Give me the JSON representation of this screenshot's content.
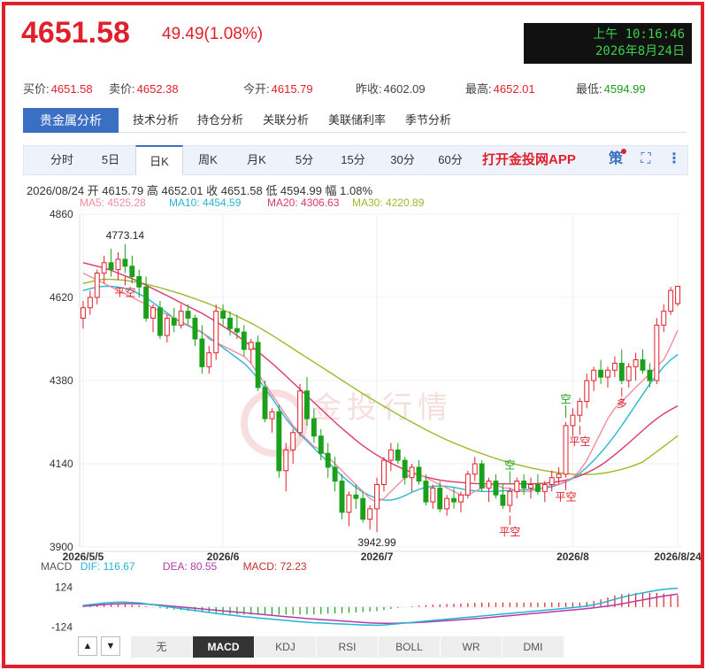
{
  "header": {
    "price": "4651.58",
    "change": "49.49(1.08%)",
    "clock_time": "上午 10:16:46",
    "clock_date": "2026年8月24日"
  },
  "quotes": [
    {
      "label": "买价:",
      "value": "4651.58",
      "tone": "red"
    },
    {
      "label": "卖价:",
      "value": "4652.38",
      "tone": "red"
    },
    {
      "label": "今开:",
      "value": "4615.79",
      "tone": "red"
    },
    {
      "label": "昨收:",
      "value": "4602.09",
      "tone": "plain"
    },
    {
      "label": "最高:",
      "value": "4652.01",
      "tone": "red"
    },
    {
      "label": "最低:",
      "value": "4594.99",
      "tone": "green"
    }
  ],
  "tabs": [
    "贵金属分析",
    "技术分析",
    "持仓分析",
    "关联分析",
    "美联储利率",
    "季节分析"
  ],
  "periods": [
    "分时",
    "5日",
    "日K",
    "周K",
    "月K",
    "5分",
    "15分",
    "30分",
    "60分"
  ],
  "active_period": "日K",
  "app_link": "打开金投网APP",
  "strategy_icon_label": "策",
  "info": {
    "line": "2026/08/24 开 4615.79 高 4652.01 收 4651.58 低 4594.99 幅 1.08%",
    "ma5": "MA5: 4525.28",
    "ma10": "MA10: 4454.59",
    "ma20": "MA20: 4306.63",
    "ma30": "MA30: 4220.89"
  },
  "macd_info": {
    "label": "MACD",
    "dif": "DIF: 116.67",
    "dea": "DEA: 80.55",
    "macd": "MACD: 72.23"
  },
  "indicator_buttons": [
    "无",
    "MACD",
    "KDJ",
    "RSI",
    "BOLL",
    "WR",
    "DMI"
  ],
  "active_indicator": "MACD",
  "watermark": "金投行情",
  "colors": {
    "up": "#e0202a",
    "down": "#1aa01a",
    "ma5": "#f08ca0",
    "ma10": "#2ab5d0",
    "ma20": "#d93a6a",
    "ma30": "#9aba2a",
    "dif": "#22b5d3",
    "dea": "#b43aa8"
  },
  "chart_data": {
    "type": "candlestick",
    "y_ticks": [
      "4860",
      "4620",
      "4380",
      "4140",
      "3900"
    ],
    "ylim": [
      3900,
      4860
    ],
    "x_ticks": [
      {
        "label": "2026/5/5",
        "index": 0
      },
      {
        "label": "2026/6",
        "index": 20
      },
      {
        "label": "2026/7",
        "index": 42
      },
      {
        "label": "2026/8",
        "index": 70
      },
      {
        "label": "2026/8/24",
        "index": 85
      }
    ],
    "annotations": [
      {
        "text": "4773.14",
        "index": 6,
        "value": 4773.14,
        "kind": "high"
      },
      {
        "text": "3942.99",
        "index": 42,
        "value": 3942.99,
        "kind": "low"
      }
    ],
    "signals": [
      {
        "text": "平空",
        "index": 6,
        "pos": "below"
      },
      {
        "text": "空",
        "index": 61,
        "pos": "above"
      },
      {
        "text": "平空",
        "index": 61,
        "pos": "below"
      },
      {
        "text": "空",
        "index": 69,
        "pos": "above"
      },
      {
        "text": "平空",
        "index": 69,
        "pos": "below"
      },
      {
        "text": "平空",
        "index": 71,
        "pos": "below"
      },
      {
        "text": "多",
        "index": 77,
        "pos": "below"
      }
    ],
    "ohlc": [
      [
        4560,
        4610,
        4530,
        4590
      ],
      [
        4590,
        4640,
        4570,
        4620
      ],
      [
        4620,
        4700,
        4600,
        4690
      ],
      [
        4690,
        4740,
        4660,
        4720
      ],
      [
        4720,
        4760,
        4680,
        4700
      ],
      [
        4700,
        4750,
        4670,
        4730
      ],
      [
        4730,
        4773,
        4690,
        4710
      ],
      [
        4710,
        4740,
        4660,
        4680
      ],
      [
        4680,
        4700,
        4620,
        4650
      ],
      [
        4650,
        4680,
        4550,
        4560
      ],
      [
        4560,
        4600,
        4520,
        4590
      ],
      [
        4590,
        4610,
        4500,
        4510
      ],
      [
        4510,
        4570,
        4490,
        4560
      ],
      [
        4560,
        4590,
        4520,
        4540
      ],
      [
        4540,
        4600,
        4530,
        4580
      ],
      [
        4580,
        4600,
        4540,
        4560
      ],
      [
        4560,
        4570,
        4480,
        4500
      ],
      [
        4500,
        4540,
        4400,
        4420
      ],
      [
        4420,
        4480,
        4400,
        4460
      ],
      [
        4460,
        4600,
        4440,
        4580
      ],
      [
        4580,
        4600,
        4540,
        4560
      ],
      [
        4560,
        4580,
        4510,
        4530
      ],
      [
        4530,
        4570,
        4500,
        4520
      ],
      [
        4520,
        4540,
        4450,
        4470
      ],
      [
        4470,
        4500,
        4430,
        4490
      ],
      [
        4490,
        4510,
        4350,
        4360
      ],
      [
        4360,
        4380,
        4260,
        4270
      ],
      [
        4270,
        4300,
        4230,
        4290
      ],
      [
        4290,
        4310,
        4100,
        4120
      ],
      [
        4120,
        4200,
        4060,
        4180
      ],
      [
        4180,
        4240,
        4140,
        4230
      ],
      [
        4230,
        4370,
        4220,
        4350
      ],
      [
        4350,
        4390,
        4250,
        4270
      ],
      [
        4270,
        4300,
        4200,
        4220
      ],
      [
        4220,
        4240,
        4150,
        4170
      ],
      [
        4170,
        4200,
        4100,
        4130
      ],
      [
        4130,
        4160,
        4060,
        4090
      ],
      [
        4090,
        4110,
        3980,
        4000
      ],
      [
        4000,
        4060,
        3960,
        4050
      ],
      [
        4050,
        4080,
        4010,
        4040
      ],
      [
        4040,
        4060,
        3970,
        3980
      ],
      [
        3980,
        4020,
        3950,
        4010
      ],
      [
        4010,
        4100,
        3943,
        4080
      ],
      [
        4080,
        4160,
        4060,
        4150
      ],
      [
        4150,
        4200,
        4120,
        4180
      ],
      [
        4180,
        4200,
        4140,
        4150
      ],
      [
        4150,
        4160,
        4080,
        4100
      ],
      [
        4100,
        4140,
        4060,
        4130
      ],
      [
        4130,
        4150,
        4080,
        4090
      ],
      [
        4090,
        4110,
        4020,
        4030
      ],
      [
        4030,
        4080,
        4010,
        4070
      ],
      [
        4070,
        4090,
        4000,
        4010
      ],
      [
        4010,
        4050,
        3990,
        4040
      ],
      [
        4040,
        4070,
        4010,
        4030
      ],
      [
        4030,
        4060,
        4000,
        4050
      ],
      [
        4050,
        4120,
        4040,
        4110
      ],
      [
        4110,
        4160,
        4090,
        4140
      ],
      [
        4140,
        4150,
        4060,
        4070
      ],
      [
        4070,
        4100,
        4030,
        4090
      ],
      [
        4090,
        4110,
        4040,
        4050
      ],
      [
        4050,
        4080,
        4010,
        4020
      ],
      [
        4020,
        4070,
        4000,
        4060
      ],
      [
        4060,
        4100,
        4040,
        4090
      ],
      [
        4090,
        4110,
        4050,
        4070
      ],
      [
        4070,
        4100,
        4040,
        4080
      ],
      [
        4080,
        4110,
        4050,
        4060
      ],
      [
        4060,
        4090,
        4030,
        4080
      ],
      [
        4080,
        4120,
        4060,
        4100
      ],
      [
        4100,
        4130,
        4080,
        4110
      ],
      [
        4110,
        4260,
        4100,
        4250
      ],
      [
        4250,
        4300,
        4220,
        4280
      ],
      [
        4280,
        4330,
        4260,
        4320
      ],
      [
        4320,
        4400,
        4300,
        4380
      ],
      [
        4380,
        4420,
        4350,
        4410
      ],
      [
        4410,
        4440,
        4370,
        4390
      ],
      [
        4390,
        4420,
        4360,
        4410
      ],
      [
        4410,
        4450,
        4390,
        4430
      ],
      [
        4430,
        4470,
        4370,
        4380
      ],
      [
        4380,
        4430,
        4360,
        4420
      ],
      [
        4420,
        4460,
        4380,
        4440
      ],
      [
        4440,
        4470,
        4400,
        4410
      ],
      [
        4410,
        4430,
        4360,
        4380
      ],
      [
        4380,
        4560,
        4370,
        4540
      ],
      [
        4540,
        4600,
        4520,
        4580
      ],
      [
        4580,
        4650,
        4570,
        4640
      ],
      [
        4602,
        4652,
        4595,
        4652
      ]
    ],
    "ma5": [
      4690,
      4680,
      4670,
      4660,
      4650,
      4640,
      4630,
      4620,
      4610,
      4600,
      4590,
      4580,
      4570,
      4560,
      4550,
      4540,
      4530,
      4520,
      4500,
      4490,
      4480,
      4470,
      4460,
      4450,
      4430,
      4400,
      4370,
      4340,
      4310,
      4280,
      4250,
      4230,
      4210,
      4190,
      4180,
      4160,
      4140,
      4120,
      4100,
      4080,
      4060,
      4040,
      4030,
      4040,
      4060,
      4080,
      4100,
      4110,
      4110,
      4100,
      4090,
      4080,
      4070,
      4060,
      4050,
      4050,
      4060,
      4070,
      4080,
      4080,
      4070,
      4070,
      4060,
      4060,
      4060,
      4070,
      4070,
      4080,
      4080,
      4090,
      4100,
      4120,
      4150,
      4190,
      4230,
      4270,
      4300,
      4320,
      4340,
      4360,
      4380,
      4400,
      4420,
      4440,
      4480,
      4525
    ],
    "ma10": [
      4640,
      4645,
      4650,
      4652,
      4652,
      4650,
      4646,
      4640,
      4630,
      4620,
      4605,
      4590,
      4575,
      4560,
      4548,
      4538,
      4528,
      4518,
      4505,
      4490,
      4475,
      4460,
      4445,
      4430,
      4410,
      4385,
      4358,
      4330,
      4300,
      4270,
      4245,
      4225,
      4205,
      4185,
      4165,
      4145,
      4125,
      4105,
      4088,
      4072,
      4058,
      4048,
      4040,
      4035,
      4035,
      4040,
      4048,
      4058,
      4066,
      4072,
      4075,
      4076,
      4075,
      4072,
      4068,
      4064,
      4062,
      4060,
      4060,
      4061,
      4062,
      4063,
      4064,
      4065,
      4066,
      4068,
      4070,
      4074,
      4080,
      4088,
      4098,
      4112,
      4130,
      4150,
      4172,
      4196,
      4222,
      4250,
      4280,
      4310,
      4340,
      4370,
      4395,
      4420,
      4440,
      4455
    ],
    "ma20": [
      4720,
      4715,
      4710,
      4705,
      4698,
      4690,
      4682,
      4674,
      4665,
      4655,
      4645,
      4635,
      4625,
      4615,
      4604,
      4594,
      4584,
      4574,
      4562,
      4550,
      4537,
      4524,
      4510,
      4495,
      4480,
      4464,
      4447,
      4430,
      4412,
      4393,
      4374,
      4355,
      4336,
      4317,
      4298,
      4279,
      4260,
      4242,
      4225,
      4208,
      4192,
      4178,
      4165,
      4153,
      4142,
      4132,
      4123,
      4115,
      4108,
      4102,
      4097,
      4093,
      4090,
      4088,
      4086,
      4084,
      4083,
      4082,
      4082,
      4082,
      4082,
      4082,
      4082,
      4082,
      4082,
      4083,
      4084,
      4086,
      4089,
      4093,
      4098,
      4105,
      4114,
      4124,
      4136,
      4150,
      4166,
      4183,
      4200,
      4218,
      4236,
      4254,
      4270,
      4284,
      4296,
      4307
    ],
    "ma30": [
      4660,
      4665,
      4670,
      4672,
      4672,
      4671,
      4669,
      4666,
      4662,
      4658,
      4653,
      4648,
      4642,
      4636,
      4630,
      4623,
      4616,
      4609,
      4601,
      4593,
      4584,
      4575,
      4566,
      4556,
      4546,
      4535,
      4523,
      4511,
      4498,
      4485,
      4472,
      4459,
      4446,
      4433,
      4420,
      4407,
      4394,
      4381,
      4368,
      4355,
      4342,
      4330,
      4318,
      4306,
      4294,
      4282,
      4271,
      4260,
      4249,
      4238,
      4228,
      4218,
      4209,
      4200,
      4192,
      4184,
      4176,
      4169,
      4162,
      4155,
      4149,
      4143,
      4138,
      4133,
      4128,
      4124,
      4120,
      4117,
      4114,
      4112,
      4110,
      4109,
      4109,
      4110,
      4112,
      4115,
      4119,
      4124,
      4130,
      4137,
      4145,
      4160,
      4175,
      4190,
      4205,
      4221
    ],
    "macd_ylim": [
      -150,
      170
    ],
    "macd_ticks": [
      "124",
      "-124"
    ],
    "dif": [
      10,
      15,
      20,
      25,
      28,
      30,
      30,
      28,
      25,
      20,
      14,
      8,
      2,
      -4,
      -10,
      -16,
      -22,
      -28,
      -34,
      -40,
      -45,
      -50,
      -55,
      -60,
      -64,
      -68,
      -72,
      -76,
      -80,
      -84,
      -88,
      -92,
      -95,
      -98,
      -100,
      -102,
      -104,
      -106,
      -108,
      -110,
      -112,
      -113,
      -114,
      -112,
      -108,
      -104,
      -100,
      -96,
      -92,
      -88,
      -84,
      -80,
      -76,
      -72,
      -68,
      -64,
      -60,
      -56,
      -52,
      -48,
      -44,
      -40,
      -36,
      -32,
      -28,
      -24,
      -20,
      -16,
      -12,
      -8,
      -4,
      0,
      6,
      14,
      24,
      36,
      48,
      60,
      70,
      80,
      88,
      96,
      104,
      110,
      114,
      117
    ],
    "dea": [
      5,
      8,
      12,
      15,
      18,
      20,
      21,
      21,
      20,
      18,
      15,
      12,
      8,
      4,
      0,
      -4,
      -8,
      -12,
      -16,
      -20,
      -24,
      -28,
      -32,
      -36,
      -40,
      -44,
      -48,
      -52,
      -56,
      -60,
      -64,
      -68,
      -72,
      -75,
      -78,
      -81,
      -84,
      -87,
      -90,
      -93,
      -96,
      -99,
      -101,
      -102,
      -102,
      -101,
      -100,
      -98,
      -96,
      -94,
      -91,
      -88,
      -85,
      -82,
      -79,
      -76,
      -73,
      -70,
      -66,
      -62,
      -58,
      -54,
      -50,
      -46,
      -42,
      -38,
      -34,
      -30,
      -26,
      -22,
      -18,
      -14,
      -10,
      -5,
      0,
      6,
      12,
      20,
      28,
      36,
      44,
      52,
      60,
      68,
      75,
      80
    ]
  }
}
